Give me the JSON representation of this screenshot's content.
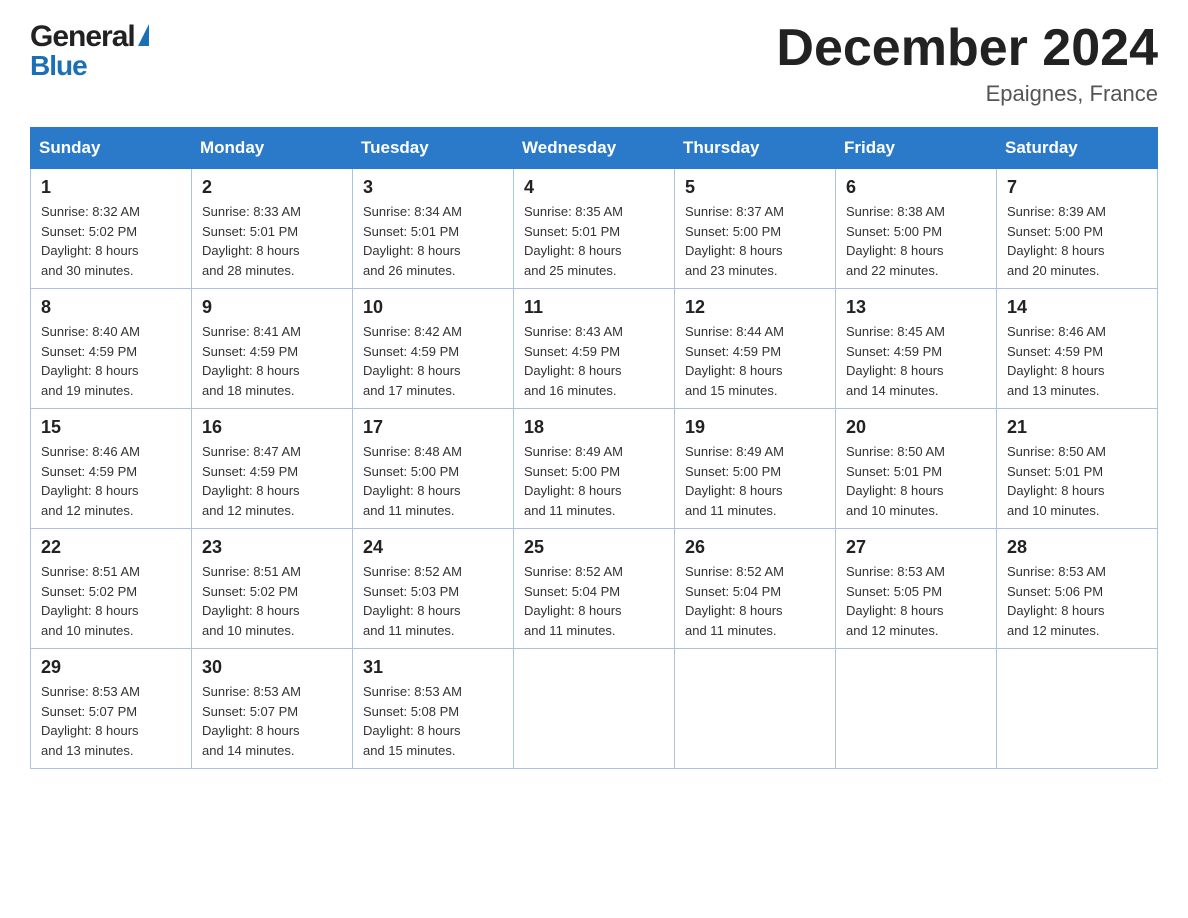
{
  "header": {
    "logo_general": "General",
    "logo_blue": "Blue",
    "month_title": "December 2024",
    "location": "Epaignes, France"
  },
  "weekdays": [
    "Sunday",
    "Monday",
    "Tuesday",
    "Wednesday",
    "Thursday",
    "Friday",
    "Saturday"
  ],
  "weeks": [
    [
      {
        "day": "1",
        "sunrise": "8:32 AM",
        "sunset": "5:02 PM",
        "daylight": "8 hours and 30 minutes."
      },
      {
        "day": "2",
        "sunrise": "8:33 AM",
        "sunset": "5:01 PM",
        "daylight": "8 hours and 28 minutes."
      },
      {
        "day": "3",
        "sunrise": "8:34 AM",
        "sunset": "5:01 PM",
        "daylight": "8 hours and 26 minutes."
      },
      {
        "day": "4",
        "sunrise": "8:35 AM",
        "sunset": "5:01 PM",
        "daylight": "8 hours and 25 minutes."
      },
      {
        "day": "5",
        "sunrise": "8:37 AM",
        "sunset": "5:00 PM",
        "daylight": "8 hours and 23 minutes."
      },
      {
        "day": "6",
        "sunrise": "8:38 AM",
        "sunset": "5:00 PM",
        "daylight": "8 hours and 22 minutes."
      },
      {
        "day": "7",
        "sunrise": "8:39 AM",
        "sunset": "5:00 PM",
        "daylight": "8 hours and 20 minutes."
      }
    ],
    [
      {
        "day": "8",
        "sunrise": "8:40 AM",
        "sunset": "4:59 PM",
        "daylight": "8 hours and 19 minutes."
      },
      {
        "day": "9",
        "sunrise": "8:41 AM",
        "sunset": "4:59 PM",
        "daylight": "8 hours and 18 minutes."
      },
      {
        "day": "10",
        "sunrise": "8:42 AM",
        "sunset": "4:59 PM",
        "daylight": "8 hours and 17 minutes."
      },
      {
        "day": "11",
        "sunrise": "8:43 AM",
        "sunset": "4:59 PM",
        "daylight": "8 hours and 16 minutes."
      },
      {
        "day": "12",
        "sunrise": "8:44 AM",
        "sunset": "4:59 PM",
        "daylight": "8 hours and 15 minutes."
      },
      {
        "day": "13",
        "sunrise": "8:45 AM",
        "sunset": "4:59 PM",
        "daylight": "8 hours and 14 minutes."
      },
      {
        "day": "14",
        "sunrise": "8:46 AM",
        "sunset": "4:59 PM",
        "daylight": "8 hours and 13 minutes."
      }
    ],
    [
      {
        "day": "15",
        "sunrise": "8:46 AM",
        "sunset": "4:59 PM",
        "daylight": "8 hours and 12 minutes."
      },
      {
        "day": "16",
        "sunrise": "8:47 AM",
        "sunset": "4:59 PM",
        "daylight": "8 hours and 12 minutes."
      },
      {
        "day": "17",
        "sunrise": "8:48 AM",
        "sunset": "5:00 PM",
        "daylight": "8 hours and 11 minutes."
      },
      {
        "day": "18",
        "sunrise": "8:49 AM",
        "sunset": "5:00 PM",
        "daylight": "8 hours and 11 minutes."
      },
      {
        "day": "19",
        "sunrise": "8:49 AM",
        "sunset": "5:00 PM",
        "daylight": "8 hours and 11 minutes."
      },
      {
        "day": "20",
        "sunrise": "8:50 AM",
        "sunset": "5:01 PM",
        "daylight": "8 hours and 10 minutes."
      },
      {
        "day": "21",
        "sunrise": "8:50 AM",
        "sunset": "5:01 PM",
        "daylight": "8 hours and 10 minutes."
      }
    ],
    [
      {
        "day": "22",
        "sunrise": "8:51 AM",
        "sunset": "5:02 PM",
        "daylight": "8 hours and 10 minutes."
      },
      {
        "day": "23",
        "sunrise": "8:51 AM",
        "sunset": "5:02 PM",
        "daylight": "8 hours and 10 minutes."
      },
      {
        "day": "24",
        "sunrise": "8:52 AM",
        "sunset": "5:03 PM",
        "daylight": "8 hours and 11 minutes."
      },
      {
        "day": "25",
        "sunrise": "8:52 AM",
        "sunset": "5:04 PM",
        "daylight": "8 hours and 11 minutes."
      },
      {
        "day": "26",
        "sunrise": "8:52 AM",
        "sunset": "5:04 PM",
        "daylight": "8 hours and 11 minutes."
      },
      {
        "day": "27",
        "sunrise": "8:53 AM",
        "sunset": "5:05 PM",
        "daylight": "8 hours and 12 minutes."
      },
      {
        "day": "28",
        "sunrise": "8:53 AM",
        "sunset": "5:06 PM",
        "daylight": "8 hours and 12 minutes."
      }
    ],
    [
      {
        "day": "29",
        "sunrise": "8:53 AM",
        "sunset": "5:07 PM",
        "daylight": "8 hours and 13 minutes."
      },
      {
        "day": "30",
        "sunrise": "8:53 AM",
        "sunset": "5:07 PM",
        "daylight": "8 hours and 14 minutes."
      },
      {
        "day": "31",
        "sunrise": "8:53 AM",
        "sunset": "5:08 PM",
        "daylight": "8 hours and 15 minutes."
      },
      null,
      null,
      null,
      null
    ]
  ],
  "labels": {
    "sunrise": "Sunrise:",
    "sunset": "Sunset:",
    "daylight": "Daylight:"
  }
}
